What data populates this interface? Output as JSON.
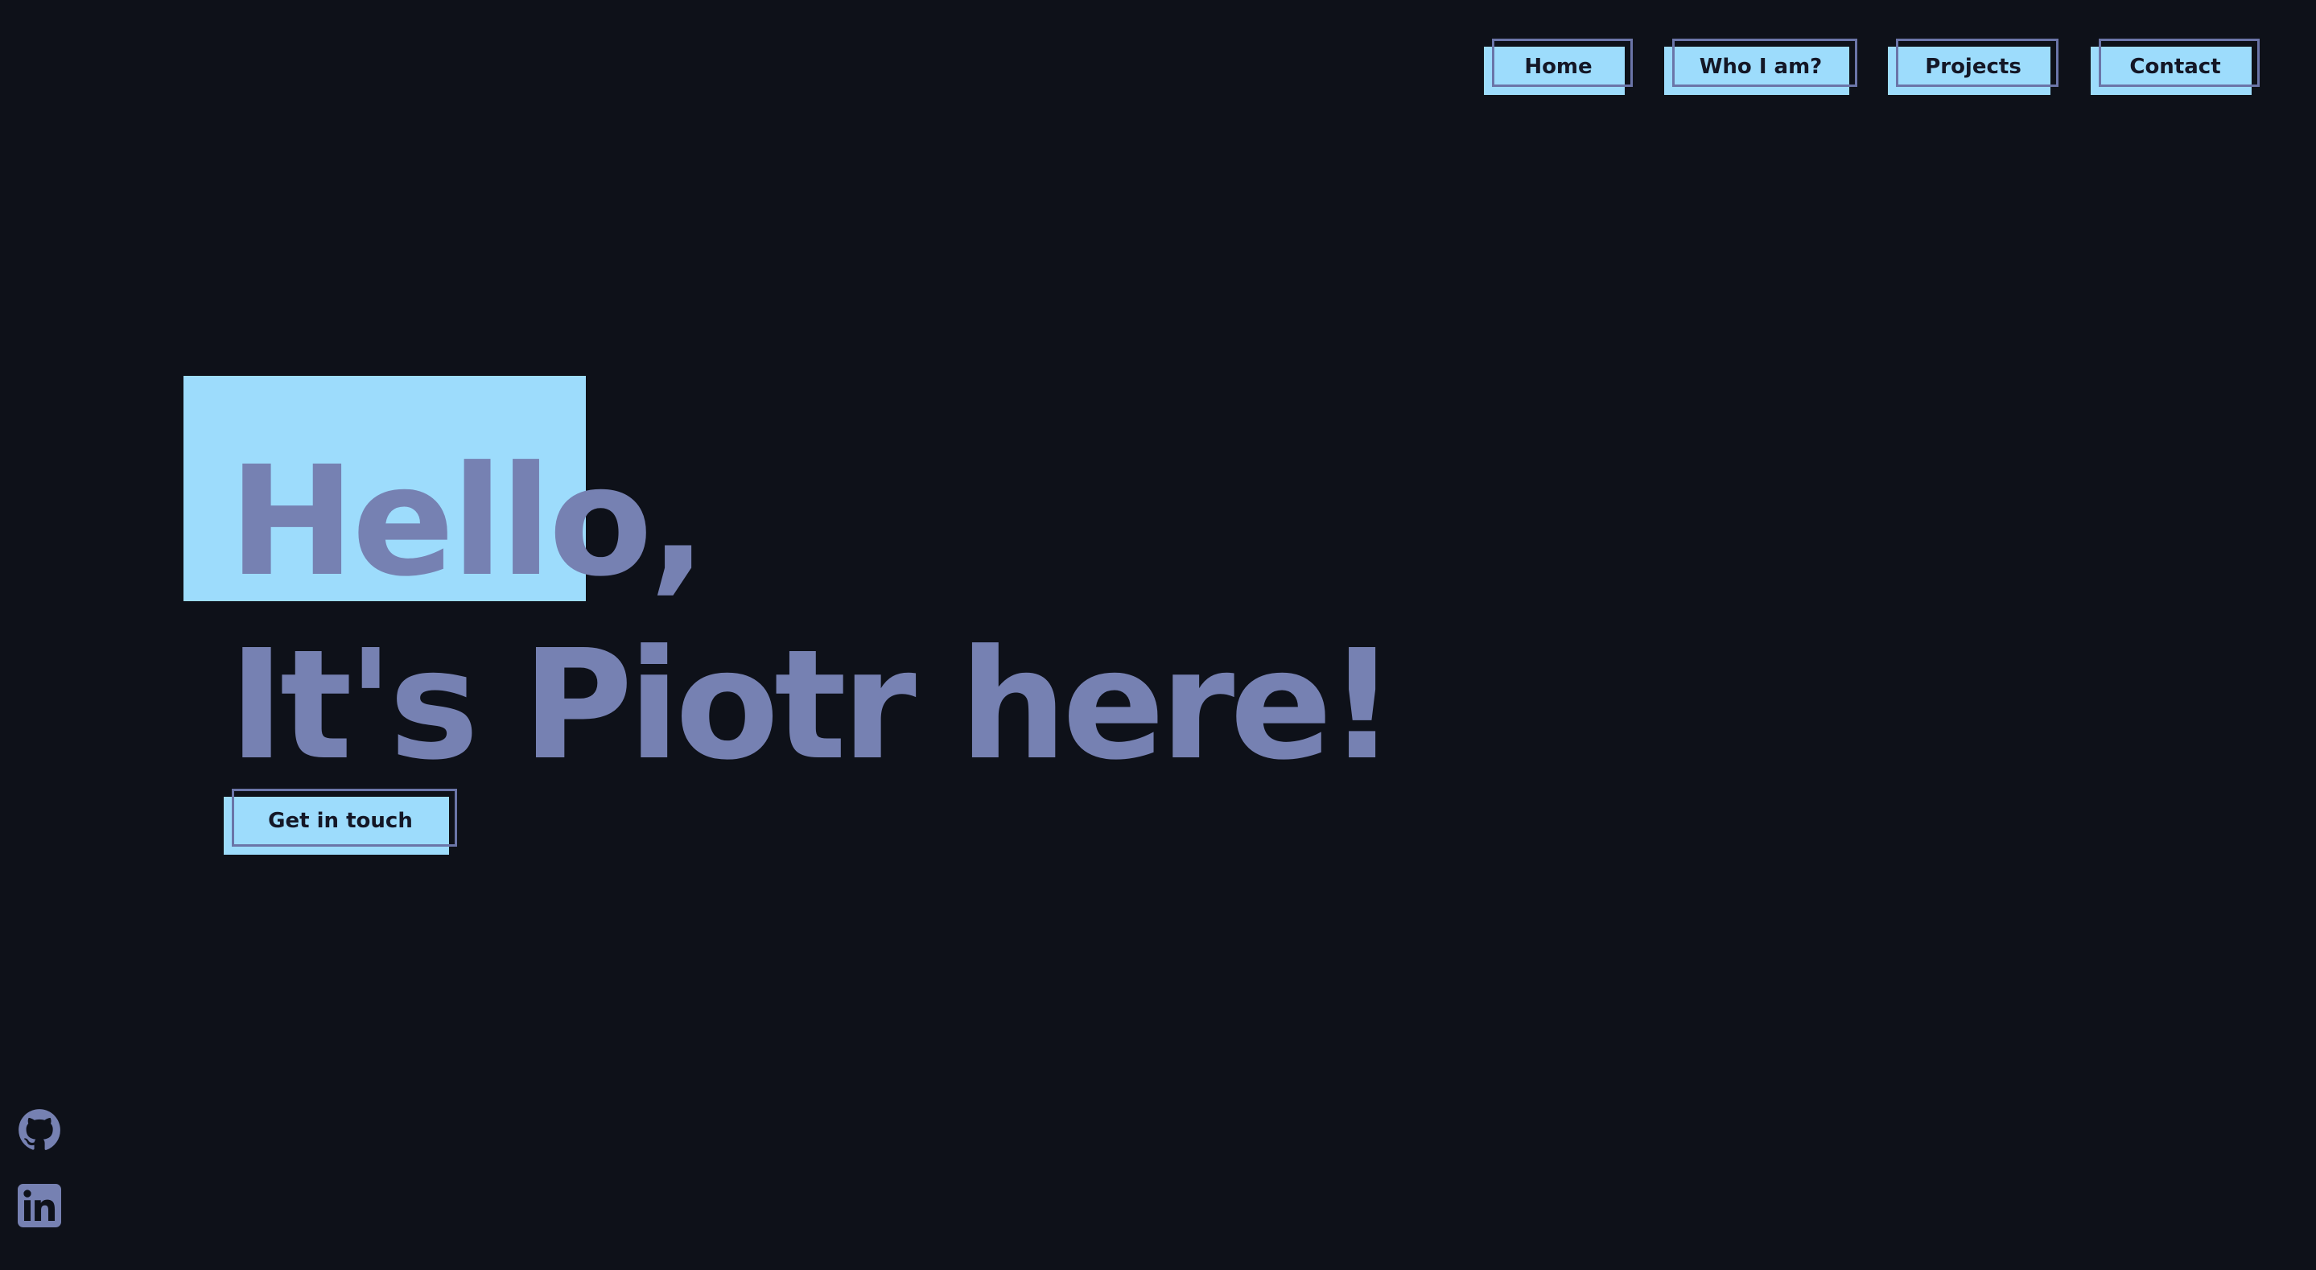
{
  "nav": {
    "items": [
      {
        "label": "Home"
      },
      {
        "label": "Who I am?"
      },
      {
        "label": "Projects"
      },
      {
        "label": "Contact"
      }
    ]
  },
  "hero": {
    "greeting": "Hello,",
    "intro": "It's Piotr here!",
    "cta_label": "Get in touch"
  },
  "social": {
    "icons": [
      "github-icon",
      "linkedin-icon"
    ]
  },
  "colors": {
    "background": "#0e1119",
    "accent": "#9ddcfc",
    "text": "#7681b2",
    "button_border": "#6b75a8",
    "button_text": "#141726"
  }
}
